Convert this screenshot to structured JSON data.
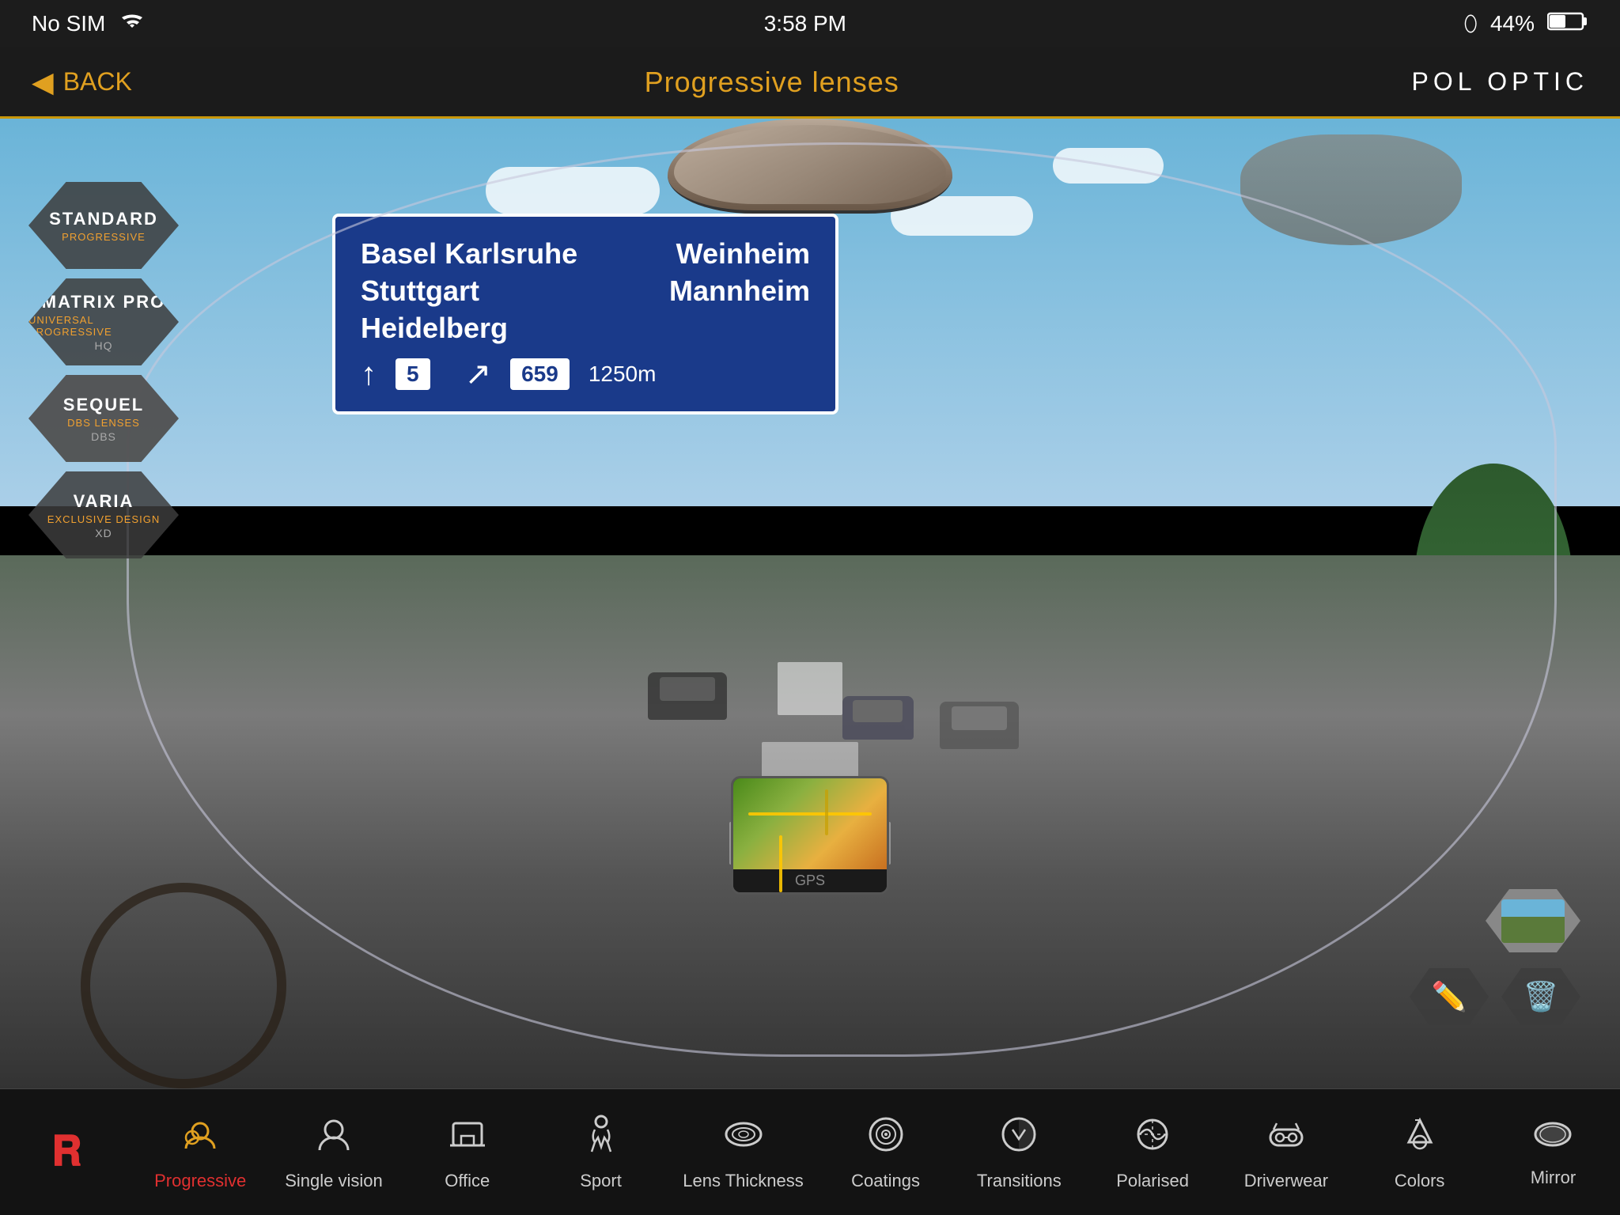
{
  "statusBar": {
    "signal": "No SIM",
    "wifi": "wifi",
    "time": "3:58 PM",
    "bluetooth": "bluetooth",
    "battery": "44%"
  },
  "topBar": {
    "backLabel": "BACK",
    "title": "Progressive lenses",
    "brand": "POL OPTIC"
  },
  "leftMenu": {
    "items": [
      {
        "id": "standard",
        "main": "STANDARD",
        "sub": "PROGRESSIVE",
        "tag": "",
        "active": false
      },
      {
        "id": "matrix-pro",
        "main": "MATRIX PRO",
        "sub": "UNIVERSAL PROGRESSIVE",
        "tag": "HQ",
        "active": false
      },
      {
        "id": "sequel",
        "main": "SEQUEL",
        "sub": "DBS LENSES",
        "tag": "DBS",
        "active": true
      },
      {
        "id": "varia",
        "main": "VARIA",
        "sub": "EXCLUSIVE DESIGN",
        "tag": "XD",
        "active": false
      }
    ]
  },
  "highwaySign": {
    "leftCity1": "Basel Karlsruhe",
    "leftCity2": "Stuttgart",
    "leftCity3": "Heidelberg",
    "leftRoute": "5",
    "rightCity1": "Weinheim",
    "rightCity2": "Mannheim",
    "rightRoute": "659",
    "distance": "1250m"
  },
  "rightIcons": {
    "photoLabel": "photo",
    "penLabel": "pen",
    "trashLabel": "trash"
  },
  "bottomNav": {
    "items": [
      {
        "id": "logo",
        "icon": "P",
        "label": "",
        "isLogo": true
      },
      {
        "id": "progressive",
        "icon": "👥",
        "label": "Progressive",
        "active": true
      },
      {
        "id": "single-vision",
        "icon": "👤",
        "label": "Single vision",
        "active": false
      },
      {
        "id": "office",
        "icon": "🖥",
        "label": "Office",
        "active": false
      },
      {
        "id": "sport",
        "icon": "🏃",
        "label": "Sport",
        "active": false
      },
      {
        "id": "lens-thickness",
        "icon": "◎",
        "label": "Lens Thickness",
        "active": false
      },
      {
        "id": "coatings",
        "icon": "◉",
        "label": "Coatings",
        "active": false
      },
      {
        "id": "transitions",
        "icon": "🔄",
        "label": "Transitions",
        "active": false
      },
      {
        "id": "polarised",
        "icon": "☀",
        "label": "Polarised",
        "active": false
      },
      {
        "id": "driverwear",
        "icon": "🚗",
        "label": "Driverwear",
        "active": false
      },
      {
        "id": "colors",
        "icon": "🎨",
        "label": "Colors",
        "active": false
      },
      {
        "id": "mirror",
        "icon": "⬜",
        "label": "Mirror",
        "active": false
      }
    ]
  }
}
